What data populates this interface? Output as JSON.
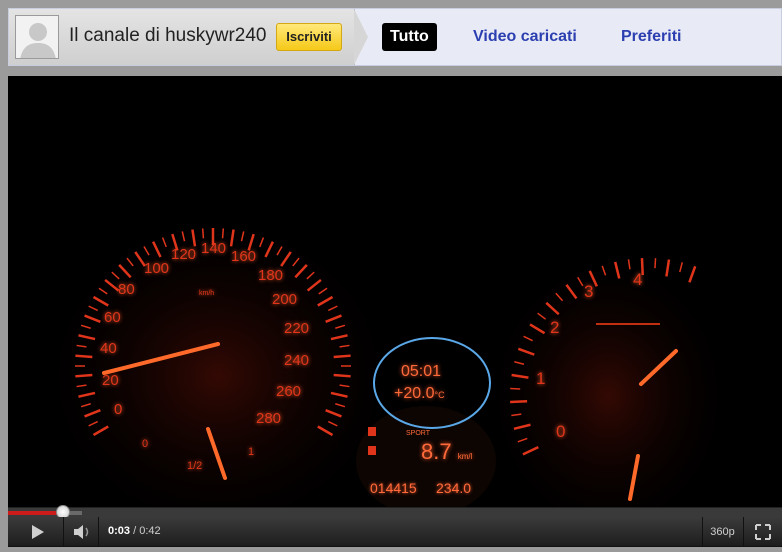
{
  "channel": {
    "name": "Il canale di huskywr240",
    "subscribe_label": "Iscriviti"
  },
  "tabs": [
    {
      "label": "Tutto",
      "active": true
    },
    {
      "label": "Video caricati",
      "active": false
    },
    {
      "label": "Preferiti",
      "active": false
    }
  ],
  "video": {
    "speedometer_ticks": [
      "0",
      "20",
      "40",
      "60",
      "80",
      "100",
      "120",
      "140",
      "160",
      "180",
      "200",
      "220",
      "240",
      "260",
      "280"
    ],
    "speedometer_unit": "km/h",
    "tachometer_ticks": [
      "1",
      "2",
      "3",
      "4"
    ],
    "fuel_ticks": [
      "0",
      "1/2",
      "1"
    ],
    "clock": "05:01",
    "temperature": "+20.0",
    "temperature_unit": "°C",
    "mode": "SPORT",
    "consumption": "8.7",
    "consumption_unit": "km/l",
    "odometer": "014415",
    "trip": "234.0",
    "highlight_color": "#5aa8e8"
  },
  "player": {
    "current_time": "0:03",
    "separator": " / ",
    "duration": "0:42",
    "progress_fraction": 0.071,
    "buffered_fraction": 0.095,
    "quality_label": "360p",
    "played_color": "#cc1b1b"
  },
  "icons": {
    "avatar": "default-user-avatar-icon",
    "play": "play-icon",
    "volume": "volume-icon",
    "fullscreen": "fullscreen-icon"
  }
}
